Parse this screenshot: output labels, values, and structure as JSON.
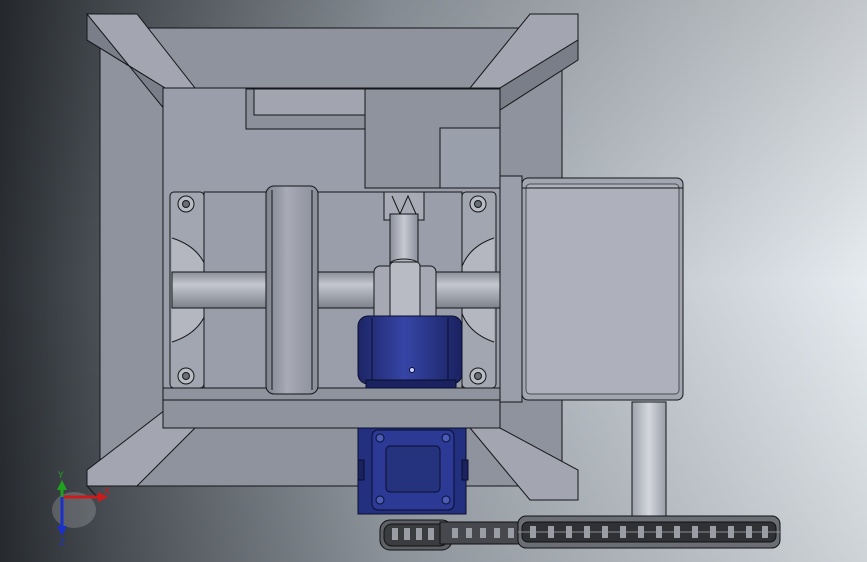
{
  "viewport": {
    "colors": {
      "background_left": "#2a2e33",
      "background_mid": "#8a929a",
      "background_right": "#e6ebf0",
      "frame": "#8f939e",
      "frame_dark": "#6c7079",
      "frame_light": "#a9acb6",
      "outline": "#15161a",
      "motor_blue": "#27348c",
      "motor_blue_dark": "#141c55",
      "motor_blue_light": "#4a5bb8",
      "chain": "#2b2b2b",
      "axis_x": "#cc1b1b",
      "axis_y": "#1fa31f",
      "axis_z": "#1b2fcc"
    }
  },
  "triad": {
    "x_label": "X",
    "y_label": "Y",
    "z_label": "Z"
  }
}
